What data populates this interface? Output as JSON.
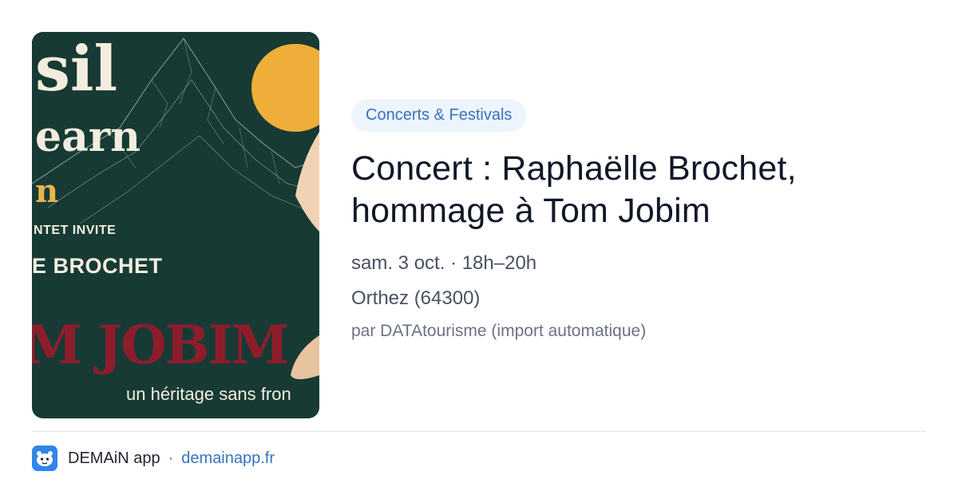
{
  "poster": {
    "line1": "sil",
    "line2": "earn",
    "line3": "n",
    "invite": "NTET INVITE",
    "artist": "E BROCHET",
    "headline": "M JOBIM",
    "tagline": "un héritage sans fron"
  },
  "event": {
    "category": "Concerts & Festivals",
    "title": "Concert : Raphaëlle Brochet, hommage à Tom Jobim",
    "datetime": "sam. 3 oct. · 18h–20h",
    "location": "Orthez (64300)",
    "source": "par DATAtourisme (import automatique)"
  },
  "footer": {
    "app_name": "DEMAiN app",
    "separator": "·",
    "site": "demainapp.fr",
    "icon": "demain-app-icon"
  },
  "colors": {
    "accent": "#3573c2",
    "poster_background": "#173a34",
    "poster_headline": "#8e1d2c",
    "sun": "#f3b340"
  }
}
